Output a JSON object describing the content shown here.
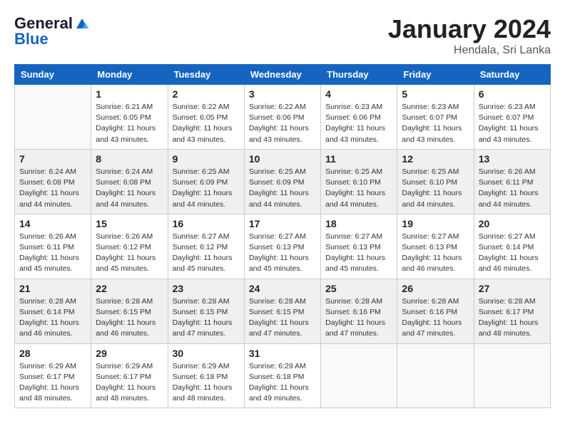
{
  "header": {
    "logo_general": "General",
    "logo_blue": "Blue",
    "month_title": "January 2024",
    "location": "Hendala, Sri Lanka"
  },
  "weekdays": [
    "Sunday",
    "Monday",
    "Tuesday",
    "Wednesday",
    "Thursday",
    "Friday",
    "Saturday"
  ],
  "rows": [
    [
      {
        "day": "",
        "sunrise": "",
        "sunset": "",
        "daylight": ""
      },
      {
        "day": "1",
        "sunrise": "Sunrise: 6:21 AM",
        "sunset": "Sunset: 6:05 PM",
        "daylight": "Daylight: 11 hours and 43 minutes."
      },
      {
        "day": "2",
        "sunrise": "Sunrise: 6:22 AM",
        "sunset": "Sunset: 6:05 PM",
        "daylight": "Daylight: 11 hours and 43 minutes."
      },
      {
        "day": "3",
        "sunrise": "Sunrise: 6:22 AM",
        "sunset": "Sunset: 6:06 PM",
        "daylight": "Daylight: 11 hours and 43 minutes."
      },
      {
        "day": "4",
        "sunrise": "Sunrise: 6:23 AM",
        "sunset": "Sunset: 6:06 PM",
        "daylight": "Daylight: 11 hours and 43 minutes."
      },
      {
        "day": "5",
        "sunrise": "Sunrise: 6:23 AM",
        "sunset": "Sunset: 6:07 PM",
        "daylight": "Daylight: 11 hours and 43 minutes."
      },
      {
        "day": "6",
        "sunrise": "Sunrise: 6:23 AM",
        "sunset": "Sunset: 6:07 PM",
        "daylight": "Daylight: 11 hours and 43 minutes."
      }
    ],
    [
      {
        "day": "7",
        "sunrise": "Sunrise: 6:24 AM",
        "sunset": "Sunset: 6:08 PM",
        "daylight": "Daylight: 11 hours and 44 minutes."
      },
      {
        "day": "8",
        "sunrise": "Sunrise: 6:24 AM",
        "sunset": "Sunset: 6:08 PM",
        "daylight": "Daylight: 11 hours and 44 minutes."
      },
      {
        "day": "9",
        "sunrise": "Sunrise: 6:25 AM",
        "sunset": "Sunset: 6:09 PM",
        "daylight": "Daylight: 11 hours and 44 minutes."
      },
      {
        "day": "10",
        "sunrise": "Sunrise: 6:25 AM",
        "sunset": "Sunset: 6:09 PM",
        "daylight": "Daylight: 11 hours and 44 minutes."
      },
      {
        "day": "11",
        "sunrise": "Sunrise: 6:25 AM",
        "sunset": "Sunset: 6:10 PM",
        "daylight": "Daylight: 11 hours and 44 minutes."
      },
      {
        "day": "12",
        "sunrise": "Sunrise: 6:25 AM",
        "sunset": "Sunset: 6:10 PM",
        "daylight": "Daylight: 11 hours and 44 minutes."
      },
      {
        "day": "13",
        "sunrise": "Sunrise: 6:26 AM",
        "sunset": "Sunset: 6:11 PM",
        "daylight": "Daylight: 11 hours and 44 minutes."
      }
    ],
    [
      {
        "day": "14",
        "sunrise": "Sunrise: 6:26 AM",
        "sunset": "Sunset: 6:11 PM",
        "daylight": "Daylight: 11 hours and 45 minutes."
      },
      {
        "day": "15",
        "sunrise": "Sunrise: 6:26 AM",
        "sunset": "Sunset: 6:12 PM",
        "daylight": "Daylight: 11 hours and 45 minutes."
      },
      {
        "day": "16",
        "sunrise": "Sunrise: 6:27 AM",
        "sunset": "Sunset: 6:12 PM",
        "daylight": "Daylight: 11 hours and 45 minutes."
      },
      {
        "day": "17",
        "sunrise": "Sunrise: 6:27 AM",
        "sunset": "Sunset: 6:13 PM",
        "daylight": "Daylight: 11 hours and 45 minutes."
      },
      {
        "day": "18",
        "sunrise": "Sunrise: 6:27 AM",
        "sunset": "Sunset: 6:13 PM",
        "daylight": "Daylight: 11 hours and 45 minutes."
      },
      {
        "day": "19",
        "sunrise": "Sunrise: 6:27 AM",
        "sunset": "Sunset: 6:13 PM",
        "daylight": "Daylight: 11 hours and 46 minutes."
      },
      {
        "day": "20",
        "sunrise": "Sunrise: 6:27 AM",
        "sunset": "Sunset: 6:14 PM",
        "daylight": "Daylight: 11 hours and 46 minutes."
      }
    ],
    [
      {
        "day": "21",
        "sunrise": "Sunrise: 6:28 AM",
        "sunset": "Sunset: 6:14 PM",
        "daylight": "Daylight: 11 hours and 46 minutes."
      },
      {
        "day": "22",
        "sunrise": "Sunrise: 6:28 AM",
        "sunset": "Sunset: 6:15 PM",
        "daylight": "Daylight: 11 hours and 46 minutes."
      },
      {
        "day": "23",
        "sunrise": "Sunrise: 6:28 AM",
        "sunset": "Sunset: 6:15 PM",
        "daylight": "Daylight: 11 hours and 47 minutes."
      },
      {
        "day": "24",
        "sunrise": "Sunrise: 6:28 AM",
        "sunset": "Sunset: 6:15 PM",
        "daylight": "Daylight: 11 hours and 47 minutes."
      },
      {
        "day": "25",
        "sunrise": "Sunrise: 6:28 AM",
        "sunset": "Sunset: 6:16 PM",
        "daylight": "Daylight: 11 hours and 47 minutes."
      },
      {
        "day": "26",
        "sunrise": "Sunrise: 6:28 AM",
        "sunset": "Sunset: 6:16 PM",
        "daylight": "Daylight: 11 hours and 47 minutes."
      },
      {
        "day": "27",
        "sunrise": "Sunrise: 6:28 AM",
        "sunset": "Sunset: 6:17 PM",
        "daylight": "Daylight: 11 hours and 48 minutes."
      }
    ],
    [
      {
        "day": "28",
        "sunrise": "Sunrise: 6:29 AM",
        "sunset": "Sunset: 6:17 PM",
        "daylight": "Daylight: 11 hours and 48 minutes."
      },
      {
        "day": "29",
        "sunrise": "Sunrise: 6:29 AM",
        "sunset": "Sunset: 6:17 PM",
        "daylight": "Daylight: 11 hours and 48 minutes."
      },
      {
        "day": "30",
        "sunrise": "Sunrise: 6:29 AM",
        "sunset": "Sunset: 6:18 PM",
        "daylight": "Daylight: 11 hours and 48 minutes."
      },
      {
        "day": "31",
        "sunrise": "Sunrise: 6:29 AM",
        "sunset": "Sunset: 6:18 PM",
        "daylight": "Daylight: 11 hours and 49 minutes."
      },
      {
        "day": "",
        "sunrise": "",
        "sunset": "",
        "daylight": ""
      },
      {
        "day": "",
        "sunrise": "",
        "sunset": "",
        "daylight": ""
      },
      {
        "day": "",
        "sunrise": "",
        "sunset": "",
        "daylight": ""
      }
    ]
  ]
}
